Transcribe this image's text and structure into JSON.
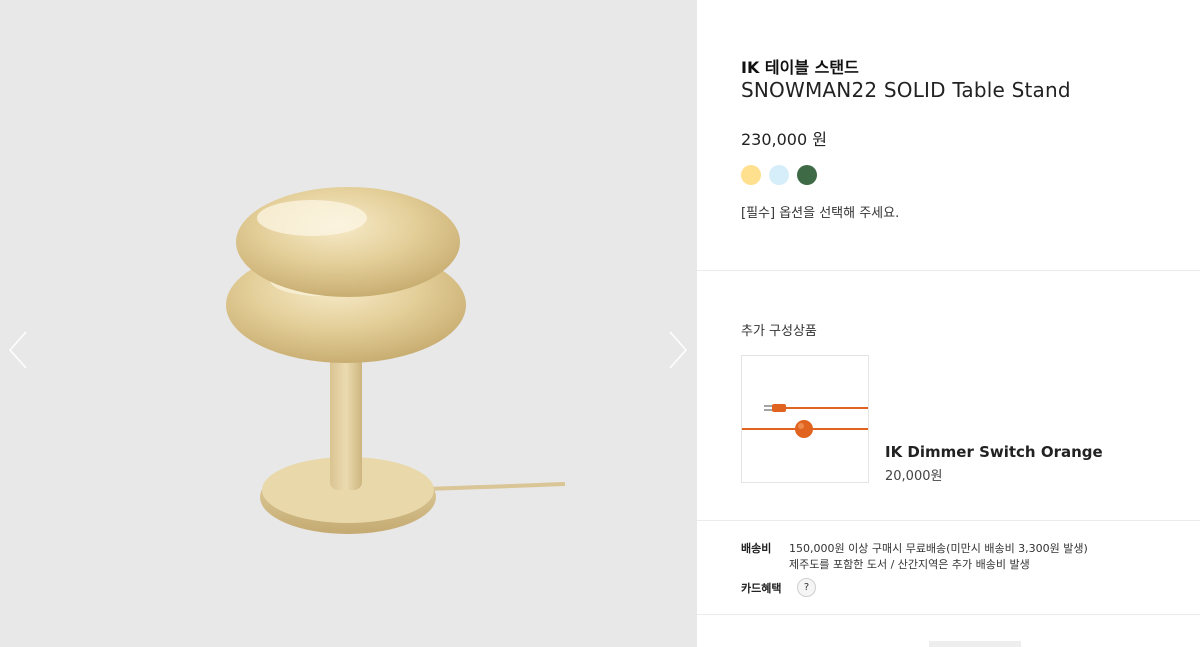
{
  "product": {
    "brand": "IK 테이블 스탠드",
    "model": "SNOWMAN22 SOLID Table Stand",
    "price": "230,000 원",
    "option_message": "[필수] 옵션을 선택해 주세요.",
    "colors": [
      "#FFE08E",
      "#D6EEF9",
      "#3E6B46"
    ]
  },
  "addon": {
    "section_title": "추가 구성상품",
    "name": "IK Dimmer Switch Orange",
    "price": "20,000원"
  },
  "shipping": {
    "label": "배송비",
    "line1": "150,000원 이상 구매시 무료배송(미만시 배송비 3,300원 발생)",
    "line2": "제주도를 포함한 도서 / 산간지역은 추가 배송비 발생"
  },
  "card_benefit": {
    "label": "카드혜택",
    "help": "?"
  },
  "icons": {
    "prev": "chevron-left-icon",
    "next": "chevron-right-icon"
  }
}
